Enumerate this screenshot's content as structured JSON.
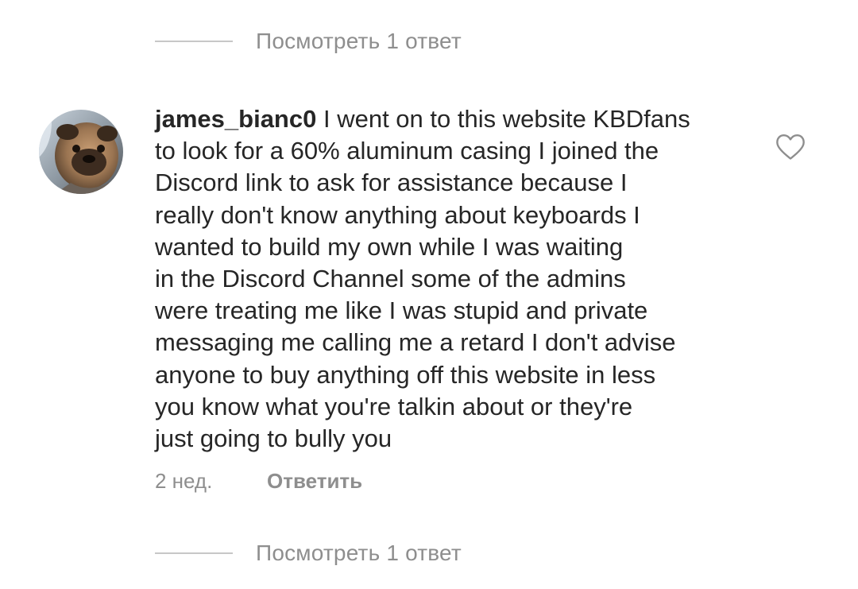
{
  "thread": {
    "view_replies_top": "Посмотреть 1 ответ",
    "view_replies_bottom": "Посмотреть 1 ответ"
  },
  "comment": {
    "username": "james_bianc0",
    "text_lines": [
      " I went on to this website KBDfans",
      "to look for a 60% aluminum casing I joined the",
      "Discord link to ask for assistance because I",
      "really don't know anything about keyboards I",
      "wanted to build my own while I was waiting",
      "in the Discord Channel some of the admins",
      "were treating me like I was stupid and private",
      "messaging me calling me a retard I don't advise",
      "anyone to buy anything off this website in less",
      "you know what you're talkin about or they're",
      "just going to bully you"
    ],
    "timestamp": "2 нед.",
    "reply_label": "Ответить",
    "avatar_icon": "avatar-photo-pug",
    "like_icon": "heart-outline-icon"
  },
  "colors": {
    "text": "#262626",
    "secondary": "#8e8e8e",
    "divider": "#c7c7c7",
    "heart_outline": "#8e8e8e"
  }
}
